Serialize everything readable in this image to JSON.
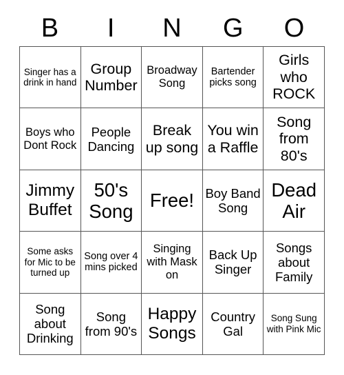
{
  "card": {
    "title_letters": [
      "B",
      "I",
      "N",
      "G",
      "O"
    ],
    "free_space_label": "Free!",
    "grid": {
      "rows": 5,
      "columns": 5,
      "border_color": "#555555",
      "background_color": "#ffffff",
      "text_color": "#000000"
    },
    "cells": [
      [
        {
          "text": "Singer has a drink in hand",
          "size": "fs-13"
        },
        {
          "text": "Group Number",
          "size": "fs-21"
        },
        {
          "text": "Broadway Song",
          "size": "fs-16"
        },
        {
          "text": "Bartender picks song",
          "size": "fs-14"
        },
        {
          "text": "Girls who ROCK",
          "size": "fs-21"
        }
      ],
      [
        {
          "text": "Boys who Dont Rock",
          "size": "fs-16"
        },
        {
          "text": "People Dancing",
          "size": "fs-18"
        },
        {
          "text": "Break up song",
          "size": "fs-21"
        },
        {
          "text": "You win a Raffle",
          "size": "fs-21"
        },
        {
          "text": "Song from 80's",
          "size": "fs-21"
        }
      ],
      [
        {
          "text": "Jimmy Buffet",
          "size": "fs-24"
        },
        {
          "text": "50's Song",
          "size": "fs-27"
        },
        {
          "text": "Free!",
          "size": "fs-27"
        },
        {
          "text": "Boy Band Song",
          "size": "fs-18"
        },
        {
          "text": "Dead Air",
          "size": "fs-27"
        }
      ],
      [
        {
          "text": "Some asks for Mic to be turned up",
          "size": "fs-13"
        },
        {
          "text": "Song over 4 mins picked",
          "size": "fs-14"
        },
        {
          "text": "Singing with Mask on",
          "size": "fs-16"
        },
        {
          "text": "Back Up Singer",
          "size": "fs-18"
        },
        {
          "text": "Songs about Family",
          "size": "fs-18"
        }
      ],
      [
        {
          "text": "Song about Drinking",
          "size": "fs-18"
        },
        {
          "text": "Song from 90's",
          "size": "fs-18"
        },
        {
          "text": "Happy Songs",
          "size": "fs-24"
        },
        {
          "text": "Country Gal",
          "size": "fs-18"
        },
        {
          "text": "Song Sung with Pink Mic",
          "size": "fs-13"
        }
      ]
    ]
  }
}
